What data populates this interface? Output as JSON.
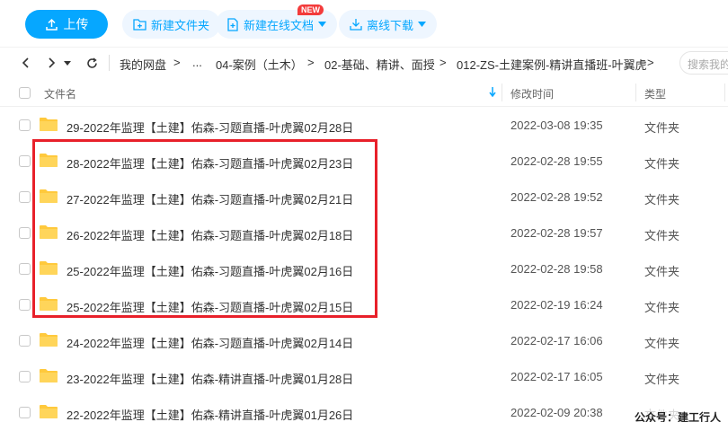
{
  "toolbar": {
    "upload_label": "上传",
    "new_folder_label": "新建文件夹",
    "new_online_doc_label": "新建在线文档",
    "new_badge": "NEW",
    "offline_download_label": "离线下载"
  },
  "nav": {
    "breadcrumbs": [
      "我的网盘",
      ">",
      "...",
      "04-案例（土木）",
      ">",
      "02-基础、精讲、面授",
      ">",
      "012-ZS-土建案例-精讲直播班-叶翼虎",
      ">"
    ],
    "search_placeholder": "搜索我的"
  },
  "table": {
    "headers": {
      "name": "文件名",
      "modified": "修改时间",
      "type": "类型"
    },
    "rows": [
      {
        "name": "29-2022年监理【土建】佑森-习题直播-叶虎翼02月28日",
        "modified": "2022-03-08 19:35",
        "type": "文件夹"
      },
      {
        "name": "28-2022年监理【土建】佑森-习题直播-叶虎翼02月23日",
        "modified": "2022-02-28 19:55",
        "type": "文件夹"
      },
      {
        "name": "27-2022年监理【土建】佑森-习题直播-叶虎翼02月21日",
        "modified": "2022-02-28 19:52",
        "type": "文件夹"
      },
      {
        "name": "26-2022年监理【土建】佑森-习题直播-叶虎翼02月18日",
        "modified": "2022-02-28 19:57",
        "type": "文件夹"
      },
      {
        "name": "25-2022年监理【土建】佑森-习题直播-叶虎翼02月16日",
        "modified": "2022-02-28 19:58",
        "type": "文件夹"
      },
      {
        "name": "25-2022年监理【土建】佑森-习题直播-叶虎翼02月15日",
        "modified": "2022-02-19 16:24",
        "type": "文件夹"
      },
      {
        "name": "24-2022年监理【土建】佑森-习题直播-叶虎翼02月14日",
        "modified": "2022-02-17 16:06",
        "type": "文件夹"
      },
      {
        "name": "23-2022年监理【土建】佑森-精讲直播-叶虎翼01月28日",
        "modified": "2022-02-17 16:05",
        "type": "文件夹"
      },
      {
        "name": "22-2022年监理【土建】佑森-精讲直播-叶虎翼01月26日",
        "modified": "2022-02-09 20:38",
        "type": "文件夹"
      }
    ]
  },
  "watermark": "公众号：建工行人",
  "colors": {
    "accent": "#06a7ff",
    "folder": "#ffc93c",
    "highlight": "#e8202a"
  },
  "icons": [
    "upload-icon",
    "new-folder-icon",
    "new-doc-icon",
    "download-icon",
    "back-icon",
    "forward-icon",
    "refresh-icon",
    "sort-arrow-icon",
    "folder-icon"
  ]
}
